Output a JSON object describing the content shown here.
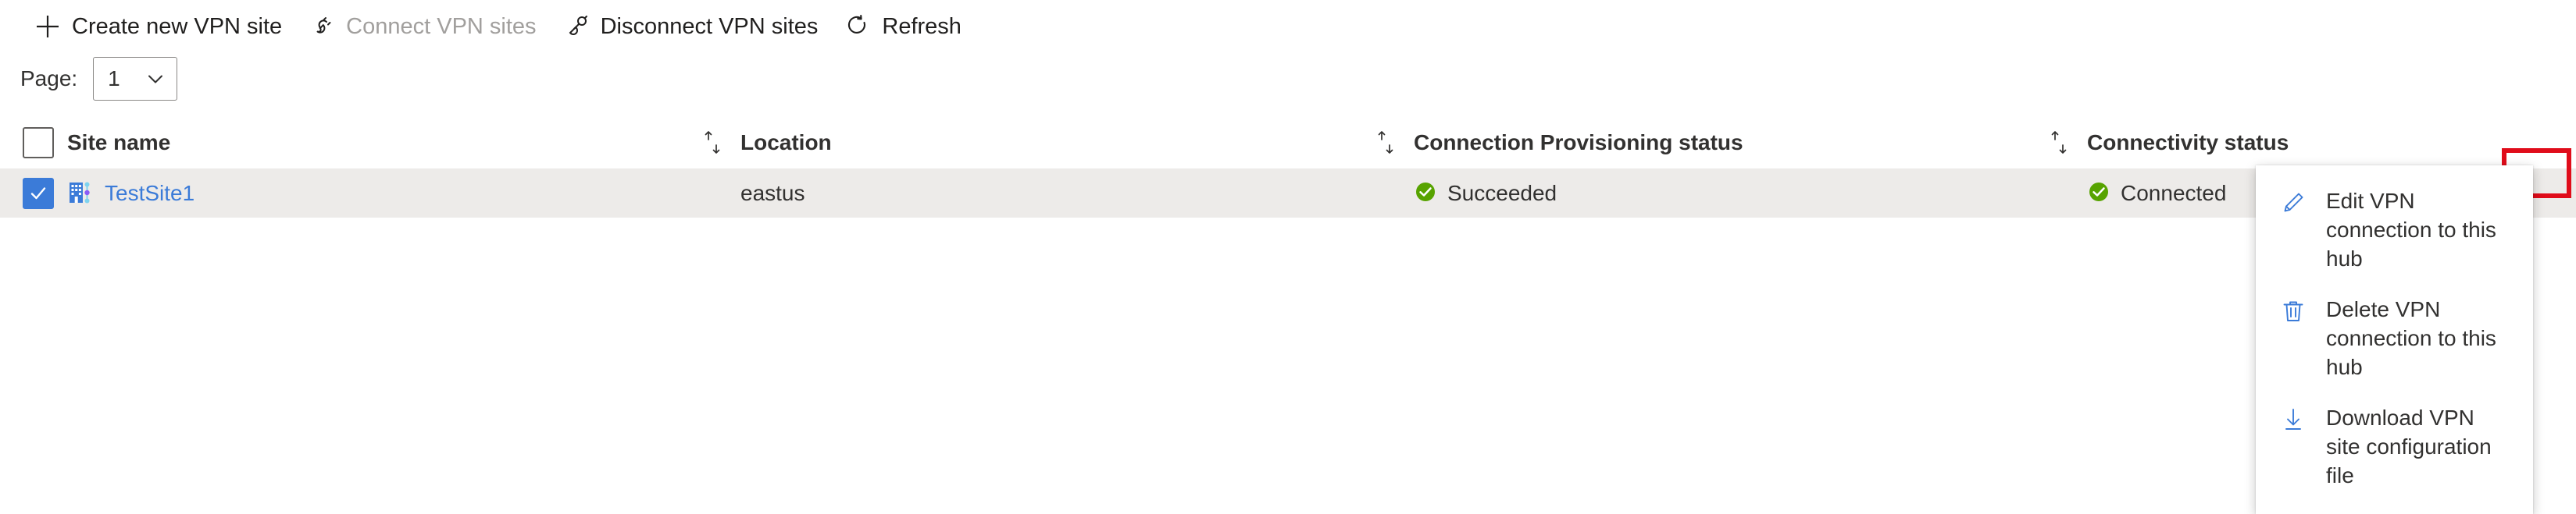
{
  "toolbar": {
    "items": [
      {
        "label": "Create new VPN site",
        "icon": "plus-icon",
        "disabled": false
      },
      {
        "label": "Connect VPN sites",
        "icon": "connect-plug-icon",
        "disabled": true
      },
      {
        "label": "Disconnect VPN sites",
        "icon": "disconnect-plug-icon",
        "disabled": false
      },
      {
        "label": "Refresh",
        "icon": "refresh-icon",
        "disabled": false
      }
    ]
  },
  "pager": {
    "label": "Page:",
    "value": "1",
    "options": [
      "1"
    ],
    "chevron_icon": "chevron-down-icon"
  },
  "table": {
    "columns": [
      {
        "key": "site_name",
        "label": "Site name",
        "sortable": false
      },
      {
        "key": "location",
        "label": "Location",
        "sortable": true
      },
      {
        "key": "provisioning",
        "label": "Connection Provisioning status",
        "sortable": true
      },
      {
        "key": "connectivity",
        "label": "Connectivity status",
        "sortable": true
      }
    ],
    "sort_icon": "sort-arrows-icon",
    "header_checkbox_checked": false,
    "rows": [
      {
        "selected": true,
        "site_name": "TestSite1",
        "site_icon": "vpn-site-icon",
        "location": "eastus",
        "provisioning": "Succeeded",
        "provisioning_icon": "success-check-icon",
        "connectivity": "Connected",
        "connectivity_icon": "success-check-icon",
        "more_icon": "ellipsis-icon"
      }
    ]
  },
  "context_menu": {
    "items": [
      {
        "label": "Edit VPN connection to this hub",
        "icon": "pencil-icon"
      },
      {
        "label": "Delete VPN connection to this hub",
        "icon": "trash-icon"
      },
      {
        "label": "Download VPN site configuration file",
        "icon": "download-icon"
      }
    ]
  },
  "colors": {
    "link": "#3b7bd8",
    "accent": "#0078d4",
    "success": "#57a300",
    "row_selected_bg": "#edebe9",
    "highlight_box": "#e00c1a",
    "disabled_text": "#a19f9d"
  }
}
